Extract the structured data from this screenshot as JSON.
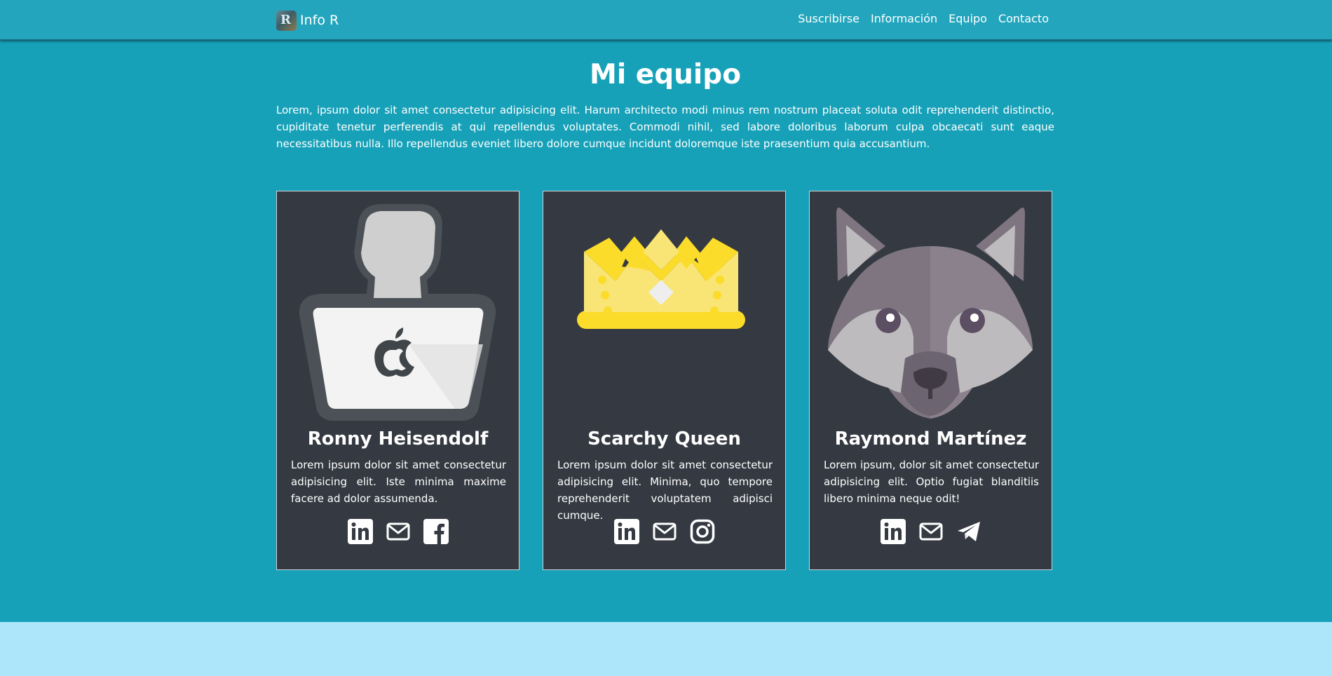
{
  "navbar": {
    "brand": "Info R",
    "brand_logo_letter": "R",
    "links": [
      "Suscribirse",
      "Información",
      "Equipo",
      "Contacto"
    ]
  },
  "section": {
    "title": "Mi equipo",
    "intro": "Lorem, ipsum dolor sit amet consectetur adipisicing elit. Harum architecto modi minus rem nostrum placeat soluta odit reprehenderit distinctio, cupiditate tenetur perferendis at qui repellendus voluptates. Commodi nihil, sed labore doloribus laborum culpa obcaecati sunt eaque necessitatibus nulla. Illo repellendus eveniet libero dolore cumque incidunt doloremque iste praesentium quia accusantium."
  },
  "team": [
    {
      "name": "Ronny Heisendolf",
      "avatar": "hacker-laptop-icon",
      "text": "Lorem ipsum dolor sit amet consectetur adipisicing elit. Iste minima maxime facere ad dolor assumenda.",
      "social": [
        "linkedin-icon",
        "mail-icon",
        "facebook-icon"
      ]
    },
    {
      "name": "Scarchy Queen",
      "avatar": "crown-icon",
      "text": "Lorem ipsum dolor sit amet consectetur adipisicing elit. Minima, quo tempore reprehenderit voluptatem adipisci cumque.",
      "social": [
        "linkedin-icon",
        "mail-icon",
        "instagram-icon"
      ]
    },
    {
      "name": "Raymond Martínez",
      "avatar": "wolf-icon",
      "text": "Lorem ipsum, dolor sit amet consectetur adipisicing elit. Optio fugiat blanditiis libero minima neque odit!",
      "social": [
        "linkedin-icon",
        "mail-icon",
        "telegram-icon"
      ]
    }
  ],
  "colors": {
    "navbar": "#23a6bd",
    "section": "#17a1b8",
    "card": "#353a42",
    "footer": "#ade6fa",
    "crown": "#f9e576",
    "crown_accent": "#fbdc2a"
  }
}
